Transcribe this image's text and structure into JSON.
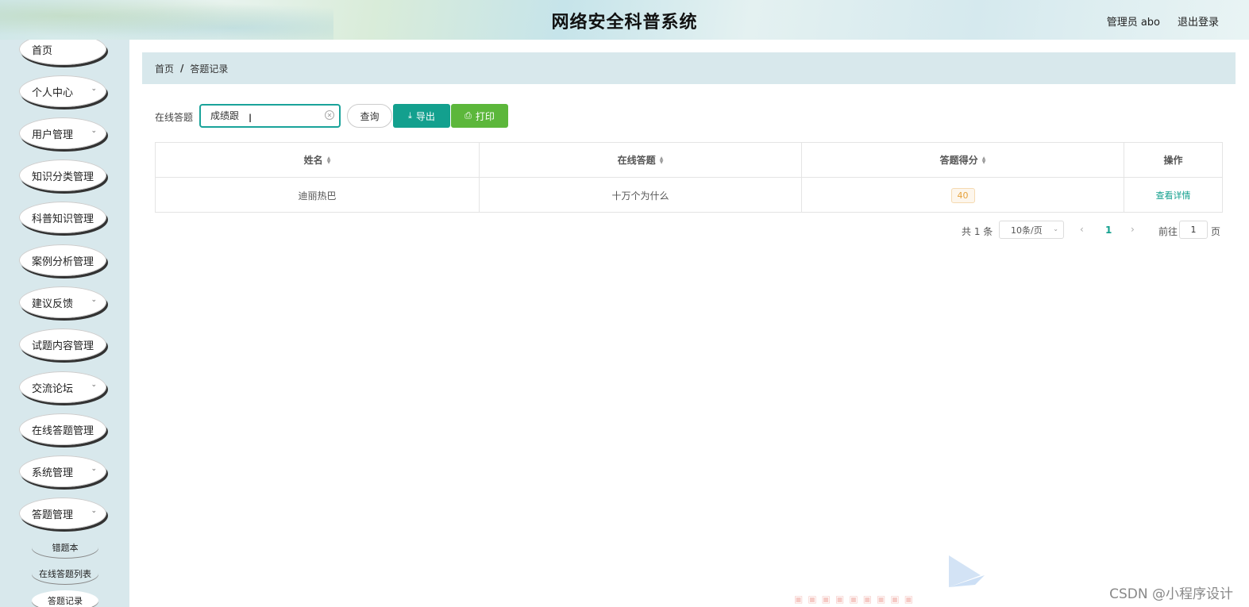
{
  "header": {
    "title": "网络安全科普系统",
    "user": "管理员 abo",
    "logout": "退出登录"
  },
  "sidebar": {
    "items": [
      {
        "label": "首页",
        "has_children": false
      },
      {
        "label": "个人中心",
        "has_children": true
      },
      {
        "label": "用户管理",
        "has_children": true
      },
      {
        "label": "知识分类管理",
        "has_children": false
      },
      {
        "label": "科普知识管理",
        "has_children": false
      },
      {
        "label": "案例分析管理",
        "has_children": false
      },
      {
        "label": "建议反馈",
        "has_children": true
      },
      {
        "label": "试题内容管理",
        "has_children": false
      },
      {
        "label": "交流论坛",
        "has_children": true
      },
      {
        "label": "在线答题管理",
        "has_children": false
      },
      {
        "label": "系统管理",
        "has_children": true
      },
      {
        "label": "答题管理",
        "has_children": true
      }
    ],
    "sub_items": [
      {
        "label": "错题本"
      },
      {
        "label": "在线答题列表"
      },
      {
        "label": "答题记录",
        "active": true
      }
    ]
  },
  "breadcrumb": {
    "home": "首页",
    "separator": "/",
    "current": "答题记录"
  },
  "search": {
    "label": "在线答题",
    "value": "成绩跟",
    "query_button": "查询",
    "export_button": "导出",
    "print_button": "打印"
  },
  "table": {
    "headers": [
      "姓名",
      "在线答题",
      "答题得分",
      "操作"
    ],
    "rows": [
      {
        "name": "迪丽热巴",
        "quiz": "十万个为什么",
        "score": "40",
        "action": "查看详情"
      }
    ]
  },
  "pagination": {
    "total": "共 1 条",
    "page_size": "10条/页",
    "current_page": "1",
    "goto_label": "前往",
    "goto_value": "1",
    "page_unit": "页"
  },
  "watermark": "CSDN @小程序设计",
  "colors": {
    "accent": "#13a08e",
    "print_button": "#5cb73b",
    "sidebar_bg": "#d8e8ec",
    "score_badge": "#e6a23c"
  }
}
